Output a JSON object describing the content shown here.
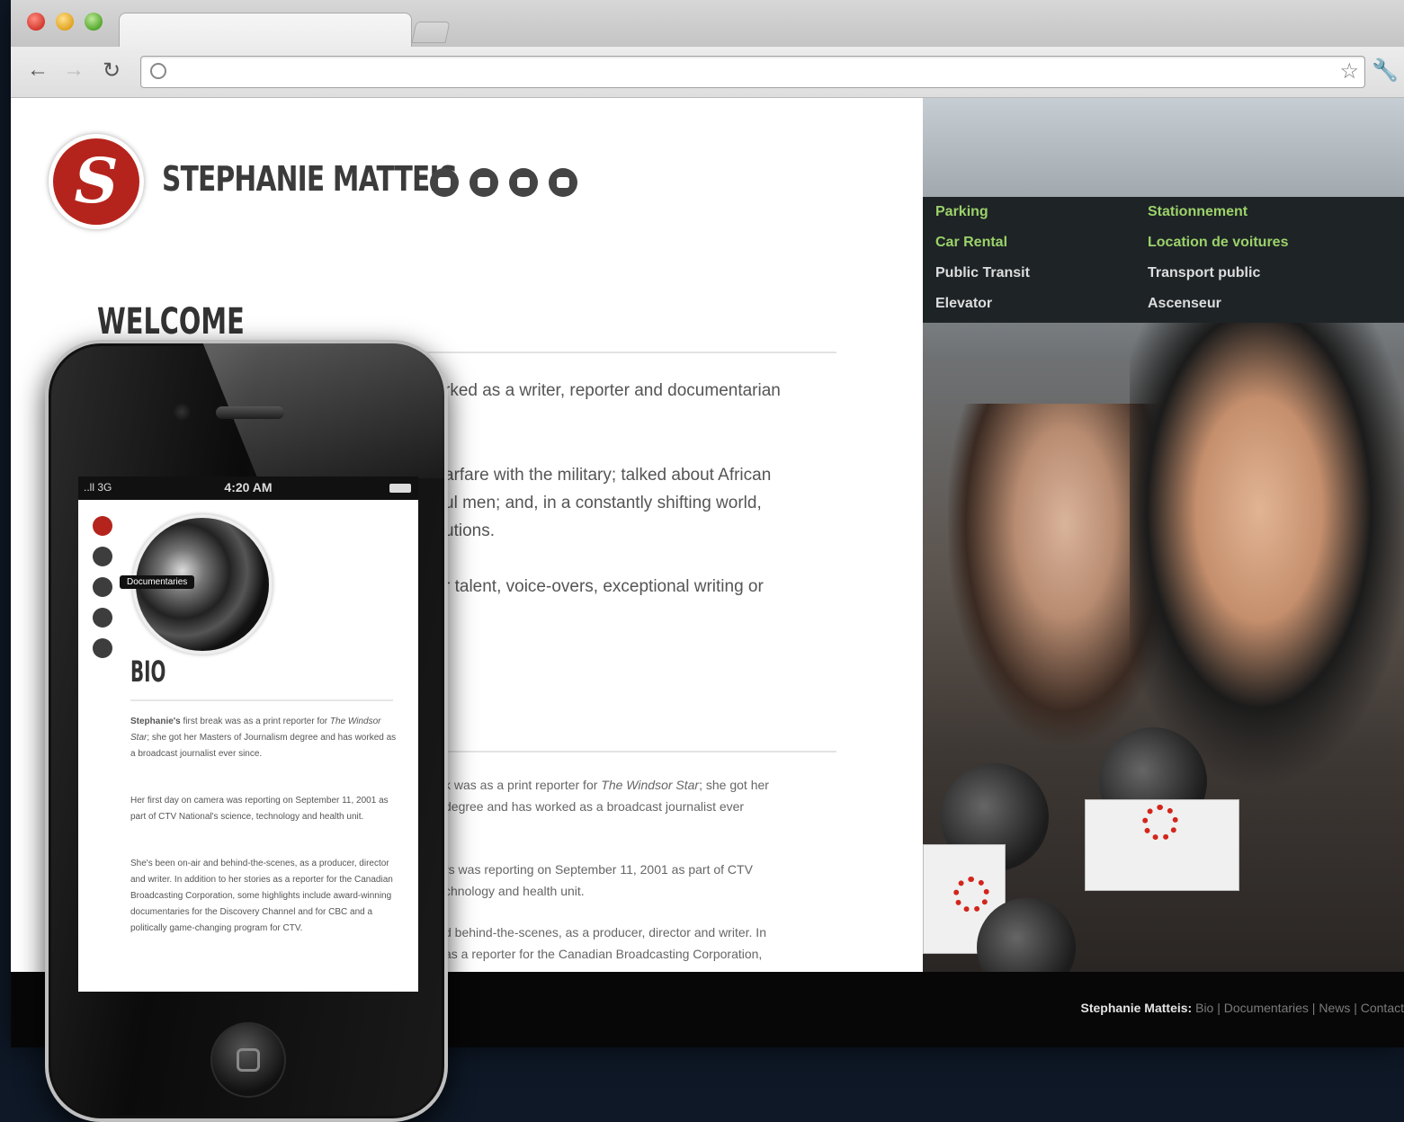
{
  "browser": {
    "url_value": "",
    "back_icon": "arrow-left-icon",
    "forward_icon": "arrow-right-icon",
    "reload_icon": "reload-icon",
    "star_icon": "star-icon",
    "wrench_icon": "wrench-icon"
  },
  "site": {
    "logo_glyph": "S",
    "name": "STEPHANIE MATTEIS",
    "social_icons": [
      "download-icon",
      "film-icon",
      "news-icon",
      "mail-icon"
    ],
    "welcome_heading": "WELCOME",
    "welcome_paragraphs": [
      [
        "rked as a writer, reporter and documentarian"
      ],
      [
        "arfare with the military; talked about African",
        "ul men; and, in a constantly shifting world,",
        "utions."
      ],
      [
        "r talent, voice-overs, exceptional writing or"
      ]
    ],
    "bio_paragraphs": [
      {
        "pre": "k was as a print reporter for ",
        "em": "The Windsor Star",
        "post": "; she got her",
        "line2": " degree and has worked as a broadcast journalist ever"
      },
      {
        "pre": "rs was reporting on September 11, 2001 as part of CTV",
        "em": "",
        "post": "",
        "line2": "chnology and health unit."
      },
      {
        "pre": "d behind-the-scenes, as a producer, director and writer. In",
        "em": "",
        "post": "",
        "line2": " as a reporter for the Canadian Broadcasting Corporation,"
      }
    ],
    "footer": {
      "name": "Stephanie Matteis:",
      "links": "Bio | Documentaries | News | Contact"
    }
  },
  "photo": {
    "sign_rows": [
      {
        "en": "Parking",
        "fr": "Stationnement"
      },
      {
        "en": "Car Rental",
        "fr": "Location de voitures"
      },
      {
        "en": "Public Transit",
        "fr": "Transport public"
      },
      {
        "en": "Elevator",
        "fr": "Ascenseur"
      }
    ]
  },
  "phone": {
    "signal": "..ll 3G",
    "time": "4:20 AM",
    "nav_icons": [
      "logo-icon",
      "download-icon",
      "film-icon",
      "news-icon",
      "mail-icon"
    ],
    "tooltip": "Documentaries",
    "bio_heading": "BIO",
    "bio_p1_strong": "Stephanie's",
    "bio_p1_a": " first break was as a print reporter for ",
    "bio_p1_em": "The Windsor Star",
    "bio_p1_b": "; she got her Masters of Journalism degree and has worked as a broadcast journalist ever since.",
    "bio_p2": "Her first day on camera was reporting on September 11, 2001 as part of CTV National's science, technology and health unit.",
    "bio_p3": "She's been on-air and behind-the-scenes, as a producer, director and writer. In addition to her stories as a reporter for the Canadian Broadcasting Corporation, some highlights include award-winning documentaries for the Discovery Channel and for CBC and a politically game-changing program for CTV."
  }
}
